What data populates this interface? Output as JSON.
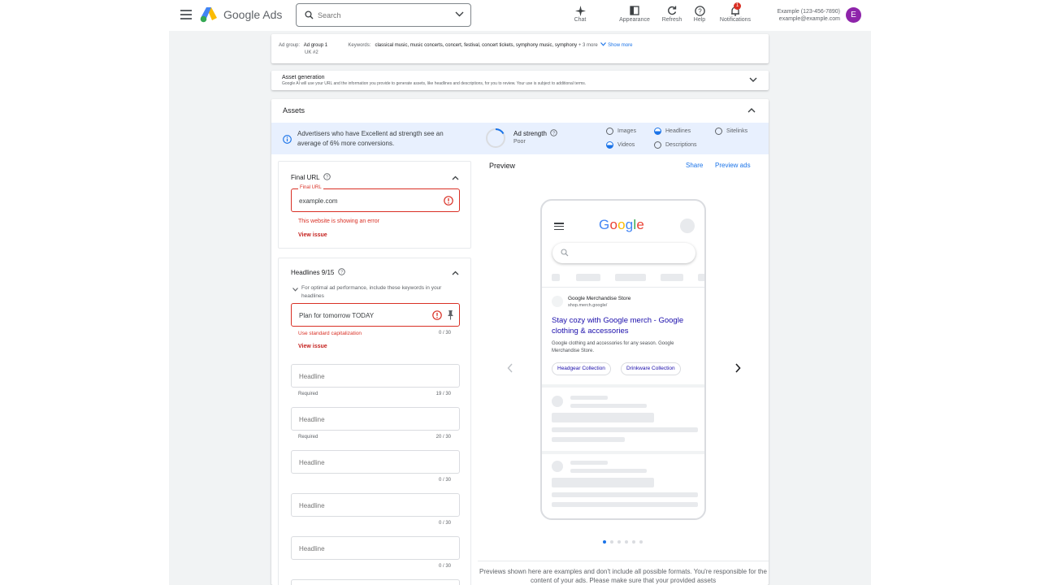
{
  "header": {
    "brand": "Google Ads",
    "search_placeholder": "Search",
    "tools": [
      {
        "label": "Chat",
        "icon": "sparkle-icon"
      },
      {
        "label": "Appearance",
        "icon": "appearance-icon"
      },
      {
        "label": "Refresh",
        "icon": "refresh-icon"
      },
      {
        "label": "Help",
        "icon": "help-icon"
      },
      {
        "label": "Notifications",
        "icon": "bell-icon",
        "badge": "1"
      }
    ],
    "account_name": "Example (123-456-7890)",
    "account_email": "example@example.com",
    "avatar_letter": "E"
  },
  "adgroup": {
    "label": "Ad group:",
    "name": "Ad group 1",
    "sub": "UK #2",
    "keywords_label": "Keywords:",
    "keywords": "classical music, music concerts, concert, festival, concert tickets, symphony music, symphony",
    "more": "+ 3 more",
    "show_more": "Show more"
  },
  "asset_gen": {
    "title": "Asset generation",
    "desc": "Google AI will use your URL and the information you provide to generate assets, like headlines and descriptions, for you to review. Your use is subject to additional terms."
  },
  "assets": {
    "title": "Assets",
    "tip": "Advertisers who have Excellent ad strength see an average of 6% more conversions.",
    "strength_label": "Ad strength",
    "strength_value": "Poor",
    "checks": [
      {
        "label": "Images",
        "state": "empty"
      },
      {
        "label": "Headlines",
        "state": "half"
      },
      {
        "label": "Sitelinks",
        "state": "empty"
      },
      {
        "label": "Videos",
        "state": "half"
      },
      {
        "label": "Descriptions",
        "state": "empty"
      }
    ]
  },
  "final_url": {
    "title": "Final URL",
    "field_label": "Final URL",
    "value": "example.com",
    "error": "This website is showing an error",
    "view_issue": "View issue"
  },
  "headlines": {
    "title": "Headlines 9/15",
    "optimal": "For optimal ad performance, include these keywords in your headlines",
    "first_value": "Plan for tomorrow TODAY",
    "first_error": "Use standard capitalization",
    "first_count": "0 / 30",
    "view_issue": "View issue",
    "placeholder": "Headline",
    "items": [
      {
        "helper": "Required",
        "count": "19 / 30"
      },
      {
        "helper": "Required",
        "count": "20 / 30"
      },
      {
        "helper": "",
        "count": "0 / 30"
      },
      {
        "helper": "",
        "count": "0 / 30"
      },
      {
        "helper": "",
        "count": "0 / 30"
      }
    ]
  },
  "preview": {
    "title": "Preview",
    "share": "Share",
    "preview_ads": "Preview ads",
    "google_letters": [
      {
        "ch": "G",
        "color": "#4285f4"
      },
      {
        "ch": "o",
        "color": "#ea4335"
      },
      {
        "ch": "o",
        "color": "#fbbc05"
      },
      {
        "ch": "g",
        "color": "#4285f4"
      },
      {
        "ch": "l",
        "color": "#34a853"
      },
      {
        "ch": "e",
        "color": "#ea4335"
      }
    ],
    "store": "Google Merchandise Store",
    "url": "shop.merch.google/",
    "headline": "Stay cozy with Google merch - Google clothing & accessories",
    "description": "Google clothing and accessories for any season. Google Merchandise Store.",
    "chips": [
      "Headgear Collection",
      "Drinkware Collection"
    ],
    "page_dots": 6,
    "active_dot": 0,
    "disclaimer": "Previews shown here are examples and don't include all possible formats. You're responsible for the content of your ads. Please make sure that your provided assets"
  }
}
